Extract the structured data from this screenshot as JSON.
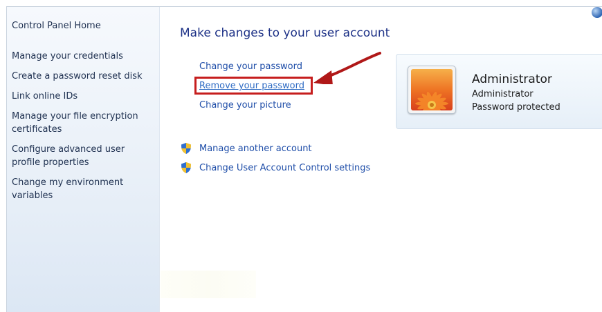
{
  "sidebar": {
    "home": "Control Panel Home",
    "items": [
      {
        "label": "Manage your credentials"
      },
      {
        "label": "Create a password reset disk"
      },
      {
        "label": "Link online IDs"
      },
      {
        "label": "Manage your file encryption certificates"
      },
      {
        "label": "Configure advanced user profile properties"
      },
      {
        "label": "Change my environment variables"
      }
    ]
  },
  "main": {
    "title": "Make changes to your user account",
    "tasks": [
      {
        "label": "Change your password"
      },
      {
        "label": "Remove your password"
      },
      {
        "label": "Change your picture"
      }
    ],
    "shield_tasks": [
      {
        "label": "Manage another account",
        "icon": "uac-shield-icon"
      },
      {
        "label": "Change User Account Control settings",
        "icon": "uac-shield-icon"
      }
    ]
  },
  "account": {
    "name": "Administrator",
    "type": "Administrator",
    "status": "Password protected",
    "picture": "flower-picture"
  },
  "annotation": {
    "highlight_color": "#c61e1e",
    "arrow_color": "#b01818"
  },
  "colors": {
    "link": "#1e4da8",
    "title": "#1e3287",
    "sidebar_text": "#1d2f4f"
  }
}
